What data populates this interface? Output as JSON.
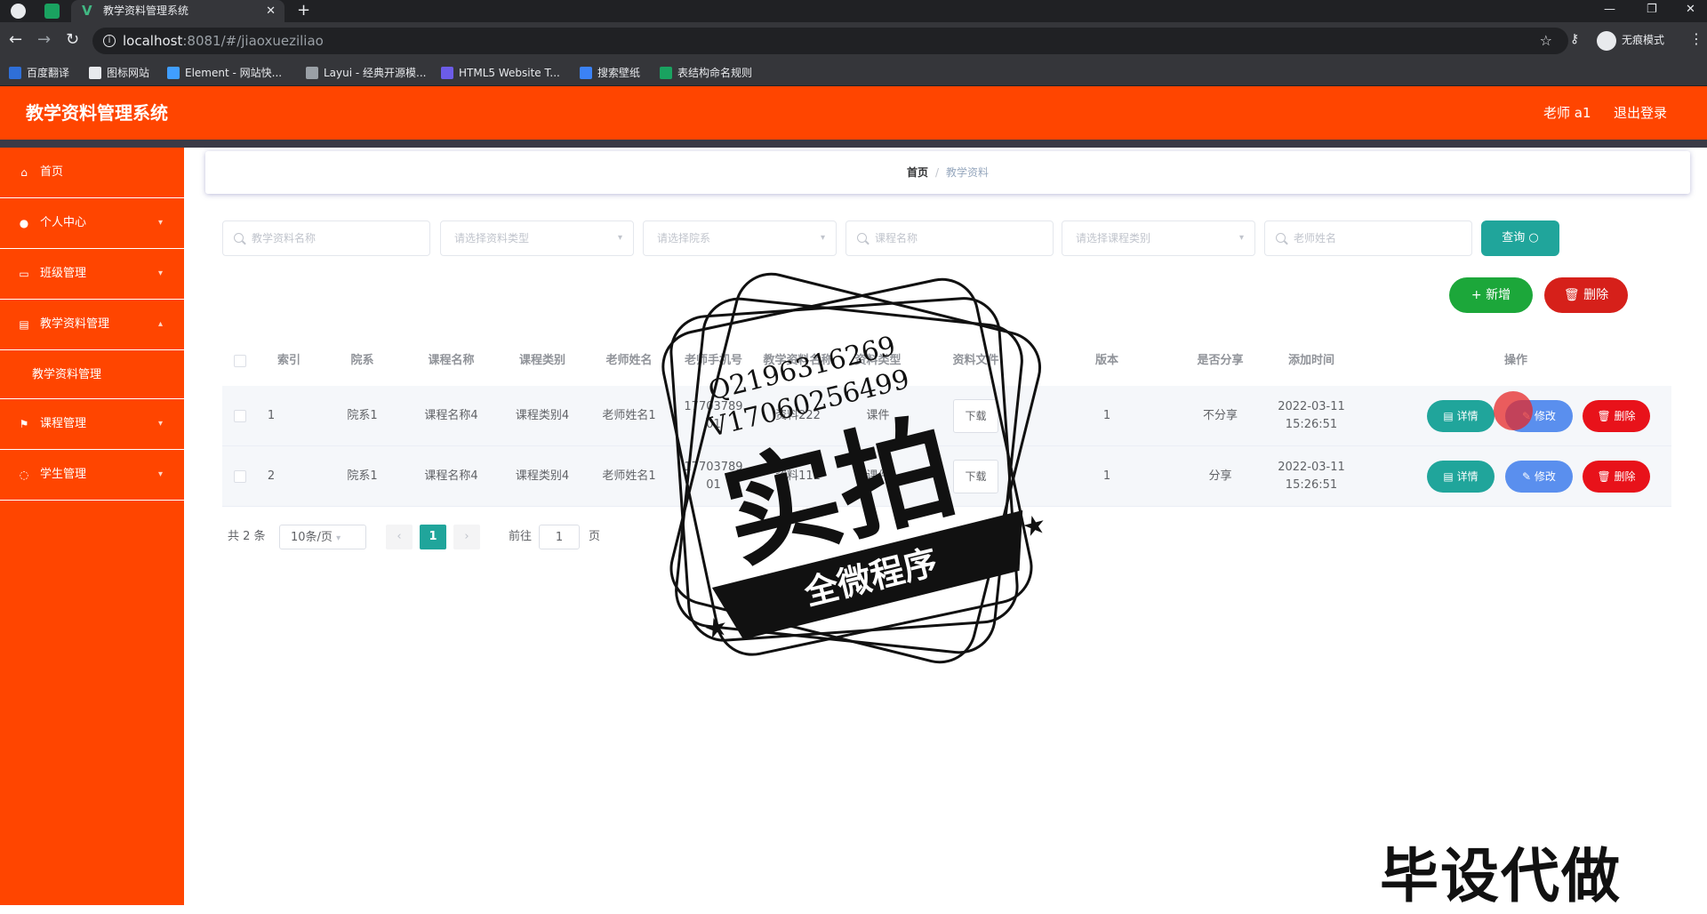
{
  "browser": {
    "tab_title": "教学资料管理系统",
    "url_host": "localhost",
    "url_path": ":8081/#/jiaoxueziliao",
    "incognito_label": "无痕模式",
    "bookmarks": [
      "百度翻译",
      "图标网站",
      "Element - 网站快...",
      "Layui - 经典开源模...",
      "HTML5 Website T...",
      "搜索壁纸",
      "表结构命名规则"
    ]
  },
  "header": {
    "title": "教学资料管理系统",
    "user": "老师 a1",
    "logout": "退出登录"
  },
  "sidebar": {
    "items": [
      {
        "label": "首页",
        "icon": "home-icon"
      },
      {
        "label": "个人中心",
        "icon": "user-icon"
      },
      {
        "label": "班级管理",
        "icon": "class-icon"
      },
      {
        "label": "教学资料管理",
        "icon": "material-icon",
        "expanded": true
      },
      {
        "label": "课程管理",
        "icon": "flag-icon"
      },
      {
        "label": "学生管理",
        "icon": "student-icon"
      }
    ],
    "submenu": "教学资料管理"
  },
  "breadcrumb": {
    "home": "首页",
    "current": "教学资料"
  },
  "filters": {
    "name_placeholder": "教学资料名称",
    "type_placeholder": "请选择资料类型",
    "college_placeholder": "请选择院系",
    "course_placeholder": "课程名称",
    "course_type_placeholder": "请选择课程类别",
    "teacher_placeholder": "老师姓名",
    "query_button": "查询"
  },
  "actions": {
    "add": "+ 新增",
    "delete": "删除"
  },
  "table": {
    "headers": [
      "索引",
      "院系",
      "课程名称",
      "课程类别",
      "老师姓名",
      "老师手机号",
      "教学资料名称",
      "资料类型",
      "资料文件",
      "版本",
      "是否分享",
      "添加时间",
      "操作"
    ],
    "rows": [
      {
        "index": "1",
        "college": "院系1",
        "course": "课程名称4",
        "category": "课程类别4",
        "teacher": "老师姓名1",
        "phone_a": "17703789",
        "phone_b": "01",
        "material": "资料222",
        "type": "课件",
        "file": "下载",
        "version": "1",
        "share": "不分享",
        "date": "2022-03-11",
        "time": "15:26:51"
      },
      {
        "index": "2",
        "college": "院系1",
        "course": "课程名称4",
        "category": "课程类别4",
        "teacher": "老师姓名1",
        "phone_a": "17703789",
        "phone_b": "01",
        "material": "资料111",
        "type": "课件",
        "file": "下载",
        "version": "1",
        "share": "分享",
        "date": "2022-03-11",
        "time": "15:26:51"
      }
    ],
    "op_detail": "详情",
    "op_edit": "修改",
    "op_delete": "删除"
  },
  "pagination": {
    "total": "共 2 条",
    "page_size": "10条/页",
    "current": "1",
    "goto_label": "前往",
    "goto_value": "1",
    "page_suffix": "页"
  },
  "watermark": {
    "line1": "Q2196316269",
    "line2": "V17060256499",
    "big": "实拍",
    "banner": "全微程序",
    "corner": "毕设代做"
  },
  "colors": {
    "header": "#ff4500",
    "teal": "#20a59b",
    "green": "#1ca73a",
    "red": "#d6201a",
    "blue": "#5a8fee"
  }
}
